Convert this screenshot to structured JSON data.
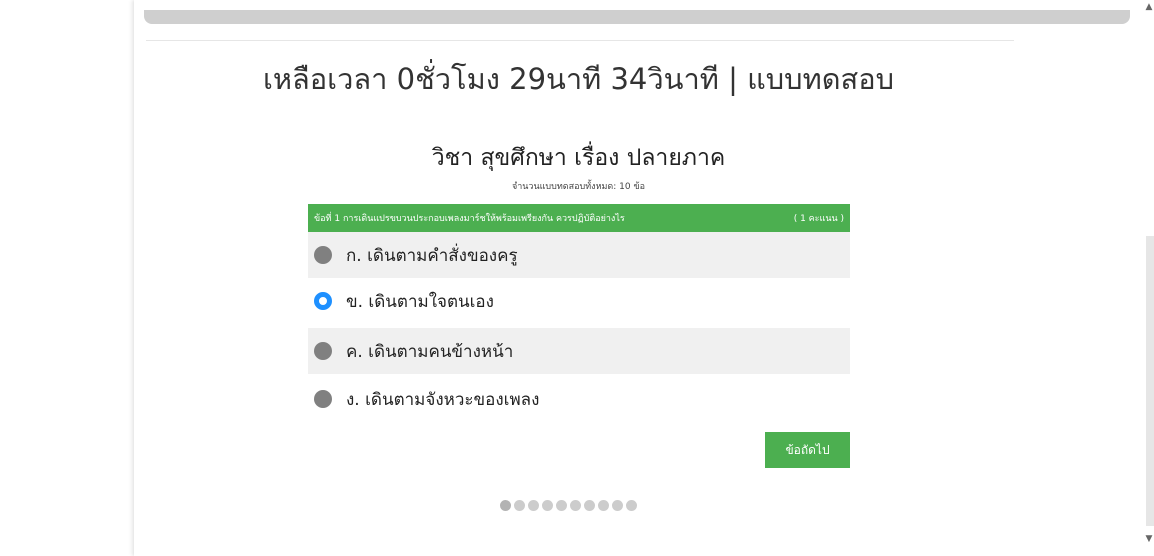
{
  "header": {
    "timer_text": "เหลือเวลา 0ชั่วโมง 29นาที 34วินาที | แบบทดสอบ"
  },
  "exam": {
    "subject_title": "วิชา สุขศึกษา เรื่อง ปลายภาค",
    "total_text": "จำนวนแบบทดสอบทั้งหมด: 10 ข้อ"
  },
  "question": {
    "header_text": "ข้อที่ 1  การเดินแปรขบวนประกอบเพลงมาร์ชให้พร้อมเพรียงกัน ควรปฏิบัติอย่างไร",
    "points_text": "( 1 คะแนน )",
    "selected_index": 1,
    "choices": [
      {
        "label": "ก.  เดินตามคำสั่งของครู"
      },
      {
        "label": "ข.  เดินตามใจตนเอง"
      },
      {
        "label": "ค.  เดินตามคนข้างหน้า"
      },
      {
        "label": "ง.  เดินตามจังหวะของเพลง"
      }
    ]
  },
  "actions": {
    "next_label": "ข้อถัดไป"
  },
  "pagination": {
    "total": 10,
    "current": 1
  },
  "colors": {
    "accent_green": "#4caf50",
    "radio_selected": "#1e90ff",
    "radio_unselected": "#808080"
  }
}
